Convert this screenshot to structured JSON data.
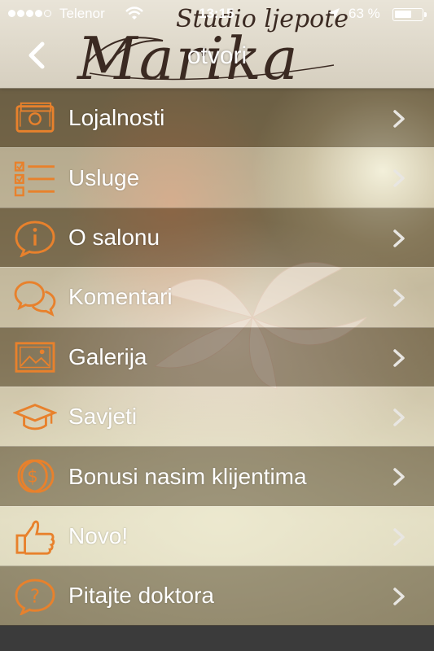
{
  "status_bar": {
    "carrier": "Telenor",
    "time": "13:15",
    "battery_percent": "63 %",
    "battery_level": 0.63,
    "signal_bars_filled": 4,
    "signal_bars_total": 5
  },
  "header": {
    "title": "otvori",
    "logo_main": "Marika",
    "logo_sub": "Studio ljepote",
    "back_icon": "chevron-left-icon"
  },
  "menu": {
    "items": [
      {
        "label": "Lojalnosti",
        "icon": "wallet-icon"
      },
      {
        "label": "Usluge",
        "icon": "checklist-icon"
      },
      {
        "label": "O salonu",
        "icon": "info-bubble-icon"
      },
      {
        "label": "Komentari",
        "icon": "chat-bubbles-icon"
      },
      {
        "label": "Galerija",
        "icon": "picture-icon"
      },
      {
        "label": "Savjeti",
        "icon": "graduation-cap-icon"
      },
      {
        "label": "Bonusi nasim klijentima",
        "icon": "coin-icon"
      },
      {
        "label": "Novo!",
        "icon": "thumbs-up-icon"
      },
      {
        "label": "Pitajte doktora",
        "icon": "question-bubble-icon"
      }
    ]
  },
  "colors": {
    "accent": "#e8812c",
    "text": "#ffffff"
  }
}
